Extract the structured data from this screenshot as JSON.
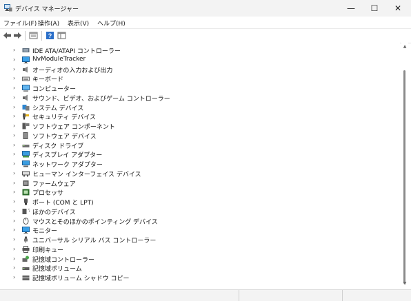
{
  "window": {
    "title": "デバイス マネージャー"
  },
  "caption": {
    "minimize": "—",
    "maximize": "☐",
    "close": "✕"
  },
  "menu": [
    {
      "label": "ファイル(F)"
    },
    {
      "label": "操作(A)"
    },
    {
      "label": "表示(V)"
    },
    {
      "label": "ヘルプ(H)"
    }
  ],
  "toolbar": {
    "buttons": [
      {
        "icon": "back-arrow-icon"
      },
      {
        "icon": "forward-arrow-icon"
      },
      {
        "icon": "properties-icon"
      },
      {
        "icon": "help-icon"
      },
      {
        "icon": "view-pane-icon"
      }
    ]
  },
  "tree": [
    {
      "label": "IDE ATA/ATAPI コントローラー",
      "icon": "ide-controller-icon"
    },
    {
      "label": "NvModuleTracker",
      "icon": "monitor-icon"
    },
    {
      "label": "オーディオの入力および出力",
      "icon": "speaker-icon"
    },
    {
      "label": "キーボード",
      "icon": "keyboard-icon"
    },
    {
      "label": "コンピューター",
      "icon": "computer-icon"
    },
    {
      "label": "サウンド、ビデオ、およびゲーム コントローラー",
      "icon": "speaker-icon"
    },
    {
      "label": "システム デバイス",
      "icon": "system-device-icon"
    },
    {
      "label": "セキュリティ デバイス",
      "icon": "security-key-icon"
    },
    {
      "label": "ソフトウェア コンポーネント",
      "icon": "software-component-icon"
    },
    {
      "label": "ソフトウェア デバイス",
      "icon": "software-device-icon"
    },
    {
      "label": "ディスク ドライブ",
      "icon": "disk-drive-icon"
    },
    {
      "label": "ディスプレイ アダプター",
      "icon": "display-adapter-icon"
    },
    {
      "label": "ネットワーク アダプター",
      "icon": "network-adapter-icon"
    },
    {
      "label": "ヒューマン インターフェイス デバイス",
      "icon": "hid-icon"
    },
    {
      "label": "ファームウェア",
      "icon": "firmware-icon"
    },
    {
      "label": "プロセッサ",
      "icon": "processor-icon"
    },
    {
      "label": "ポート (COM と LPT)",
      "icon": "port-icon"
    },
    {
      "label": "ほかのデバイス",
      "icon": "unknown-device-icon"
    },
    {
      "label": "マウスとそのほかのポインティング デバイス",
      "icon": "mouse-icon"
    },
    {
      "label": "モニター",
      "icon": "monitor-icon"
    },
    {
      "label": "ユニバーサル シリアル バス コントローラー",
      "icon": "usb-icon"
    },
    {
      "label": "印刷キュー",
      "icon": "printer-icon"
    },
    {
      "label": "記憶域コントローラー",
      "icon": "storage-controller-icon"
    },
    {
      "label": "記憶域ボリューム",
      "icon": "storage-volume-icon"
    },
    {
      "label": "記憶域ボリューム シャドウ コピー",
      "icon": "shadow-copy-icon"
    }
  ],
  "colors": {
    "titlebar": "#f3f3f3",
    "accent": "#2b7cd3",
    "statusbar": "#f3f3f3"
  }
}
